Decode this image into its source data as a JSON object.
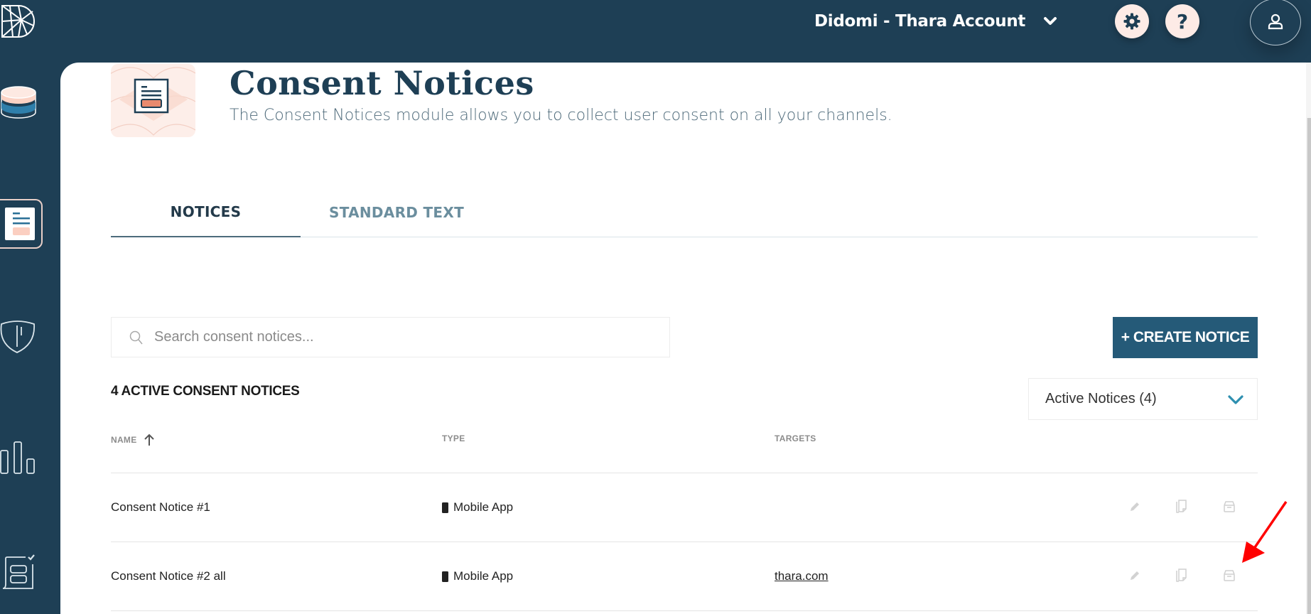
{
  "header": {
    "logo_icon": "didomi-logo-icon",
    "account_name": "Didomi - Thara Account",
    "account_dropdown_icon": "chevron-down-icon",
    "settings_icon": "gear-icon",
    "help_label": "?",
    "help_icon": "question-icon",
    "user_icon": "user-icon"
  },
  "sidebar": {
    "items": [
      {
        "name": "data-manager",
        "icon": "database-icon",
        "active": false
      },
      {
        "name": "consent-notices",
        "icon": "document-icon",
        "active": true
      },
      {
        "name": "privacy-requests",
        "icon": "shield-icon",
        "active": false
      },
      {
        "name": "analytics",
        "icon": "bar-chart-icon",
        "active": false
      },
      {
        "name": "preference-center",
        "icon": "form-check-icon",
        "active": false
      }
    ]
  },
  "page": {
    "title": "Consent Notices",
    "subtitle": "The Consent Notices module allows you to collect user consent on all your channels."
  },
  "tabs": [
    {
      "label": "NOTICES",
      "active": true
    },
    {
      "label": "STANDARD TEXT",
      "active": false
    }
  ],
  "search": {
    "placeholder": "Search consent notices...",
    "value": ""
  },
  "create_button": {
    "label": "+ CREATE NOTICE"
  },
  "notice_count_label": "4 ACTIVE CONSENT NOTICES",
  "filter": {
    "selected": "Active Notices (4)"
  },
  "table": {
    "columns": [
      {
        "label": "NAME",
        "sort": "ascending"
      },
      {
        "label": "TYPE"
      },
      {
        "label": "TARGETS"
      }
    ],
    "rows": [
      {
        "name": "Consent Notice #1",
        "type": "Mobile App",
        "targets": "",
        "actions": [
          "edit",
          "duplicate",
          "archive"
        ]
      },
      {
        "name": "Consent Notice #2 all",
        "type": "Mobile App",
        "targets": "thara.com",
        "actions": [
          "edit",
          "duplicate",
          "archive"
        ]
      }
    ]
  },
  "annotation": {
    "arrow_color": "#ff0000",
    "points_to": "archive action, row 2"
  },
  "colors": {
    "navy": "#1e3f55",
    "button": "#255a78",
    "accent_peach": "#fdebe6",
    "chevron_teal": "#2e8fb0"
  }
}
